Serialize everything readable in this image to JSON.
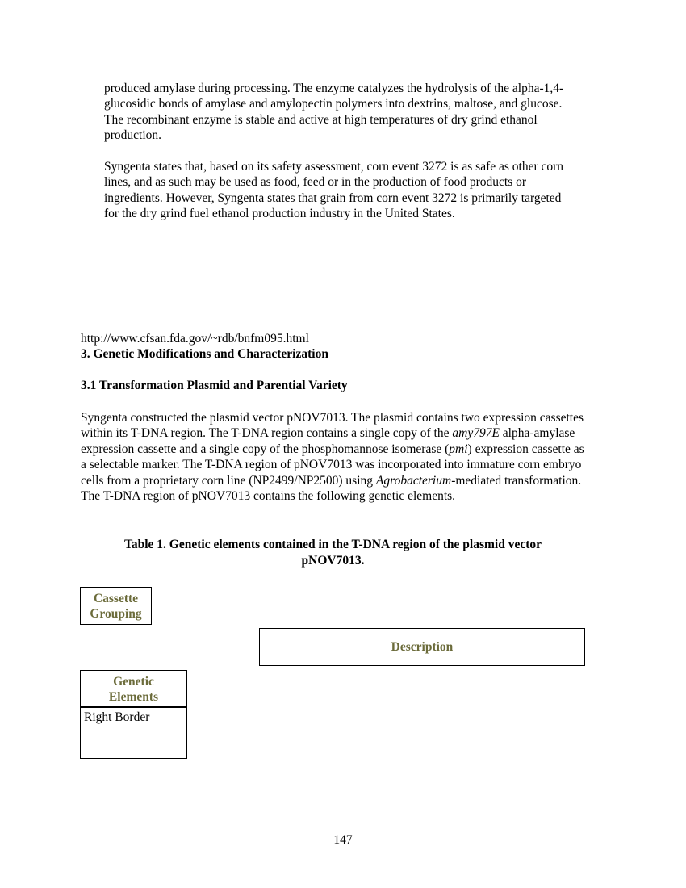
{
  "intro": {
    "para1": "produced amylase during processing. The enzyme catalyzes the hydrolysis of the alpha-1,4-glucosidic bonds of amylase and amylopectin polymers into dextrins, maltose, and glucose. The recombinant enzyme is stable and active at high temperatures of dry grind ethanol production.",
    "para2": "Syngenta states that, based on its safety assessment, corn event 3272 is as safe as other corn lines, and as such may be used as food, feed or in the production of food products or ingredients. However, Syngenta states that grain from corn event 3272 is primarily targeted for the dry grind fuel ethanol production industry in the United States."
  },
  "url": "http://www.cfsan.fda.gov/~rdb/bnfm095.html",
  "section3": {
    "heading": "3. Genetic Modifications and Characterization",
    "subheading": "3.1 Transformation Plasmid and Parential Variety",
    "body": {
      "s1": "Syngenta constructed the plasmid vector pNOV7013. The plasmid contains two expression cassettes within its T-DNA region. The T-DNA region contains a single copy of the ",
      "gene1": "amy797E",
      "s2": " alpha-amylase expression cassette and a single copy of the phosphomannose isomerase (",
      "gene2": "pmi",
      "s3": ") expression cassette as a selectable marker. The T-DNA region of pNOV7013 was incorporated into immature corn embryo cells from a proprietary corn line (NP2499/NP2500) using ",
      "organism": "Agrobacterium",
      "s4": "-mediated transformation. The T-DNA region of pNOV7013 contains the following genetic elements."
    }
  },
  "table": {
    "caption_line1": "Table 1. Genetic elements contained in the T-DNA region of the plasmid vector",
    "caption_line2": "pNOV7013.",
    "col_cassette_l1": "Cassette",
    "col_cassette_l2": "Grouping",
    "col_description": "Description",
    "col_genetic_l1": "Genetic",
    "col_genetic_l2": "Elements",
    "row1_element": "Right Border"
  },
  "page_number": "147"
}
